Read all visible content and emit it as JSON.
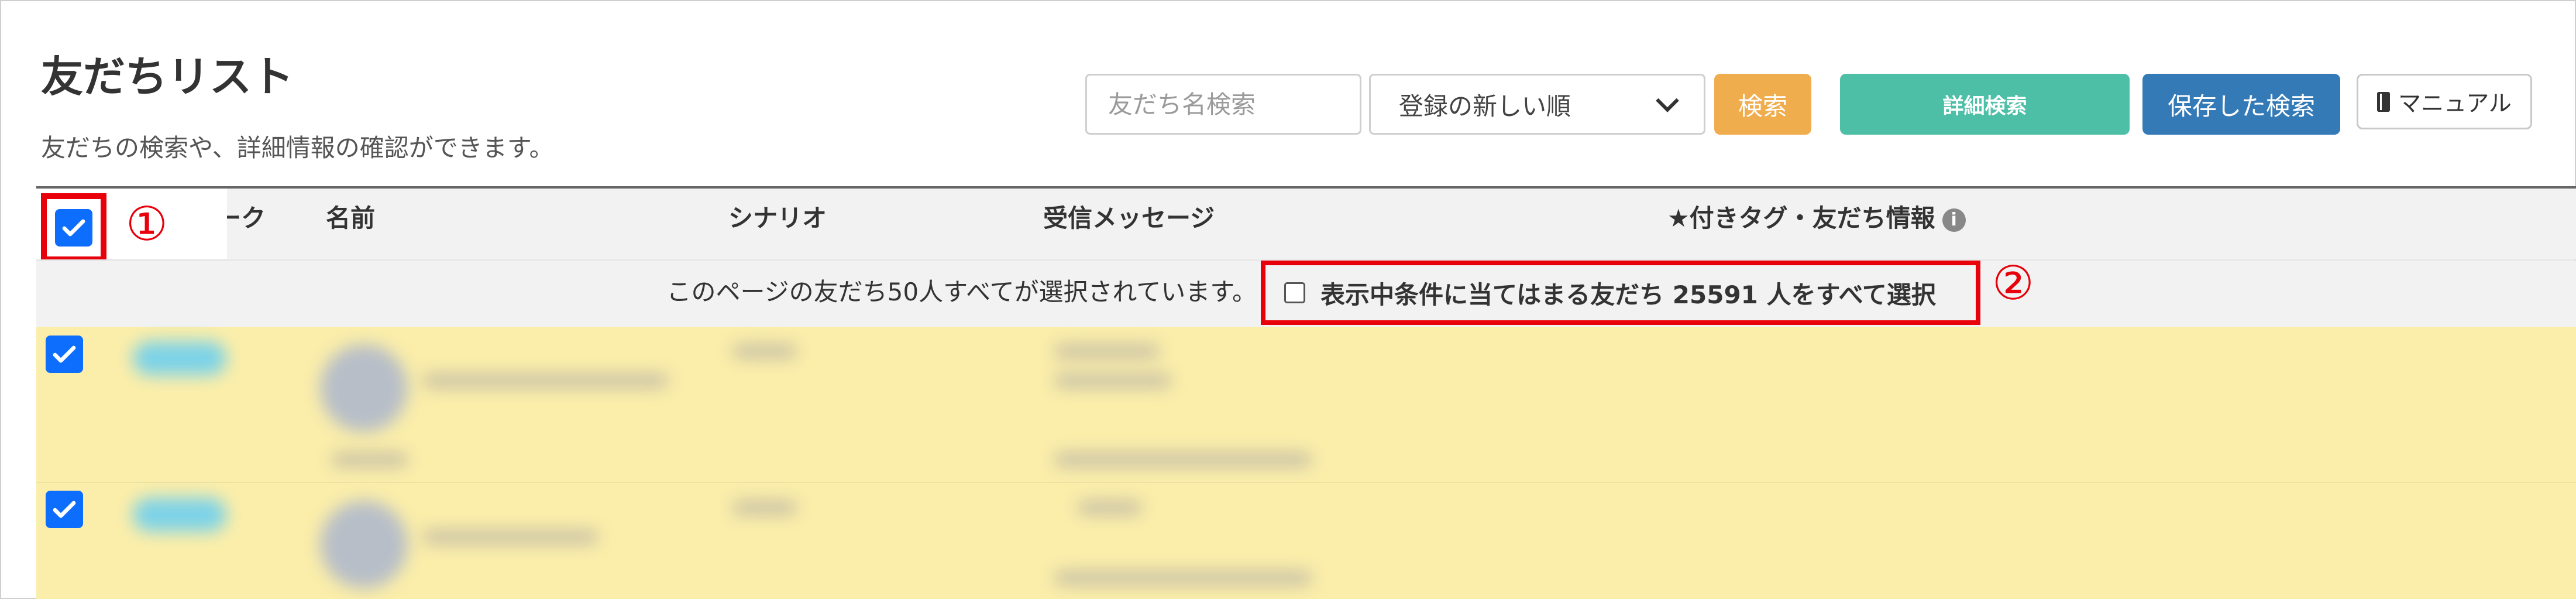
{
  "page": {
    "title": "友だちリスト",
    "subtitle": "友だちの検索や、詳細情報の確認ができます。"
  },
  "toolbar": {
    "search_placeholder": "友だち名検索",
    "sort_selected": "登録の新しい順",
    "search_button": "検索",
    "detail_search_button": "詳細検索",
    "saved_search_button": "保存した検索",
    "manual_button": "マニュアル"
  },
  "table": {
    "columns": [
      "ーク",
      "名前",
      "シナリオ",
      "受信メッセージ",
      "★付きタグ・友だち情報"
    ],
    "selection_notice": "このページの友だち50人すべてが選択されています。",
    "select_all_label": "表示中条件に当てはまる友だち 25591 人をすべて選択"
  },
  "annotations": {
    "marker1": "①",
    "marker2": "②",
    "color": "#e8000b"
  },
  "colors": {
    "checkbox": "#0d6efd",
    "row_highlight": "#fbeeaa",
    "search_button": "#f0ad4e",
    "detail_button": "#4cbfa6",
    "saved_button": "#337ab7"
  },
  "icons": {
    "manual": "book-icon",
    "info": "info-icon",
    "select": "chevron-down-icon",
    "checkbox": "checkmark-icon"
  }
}
